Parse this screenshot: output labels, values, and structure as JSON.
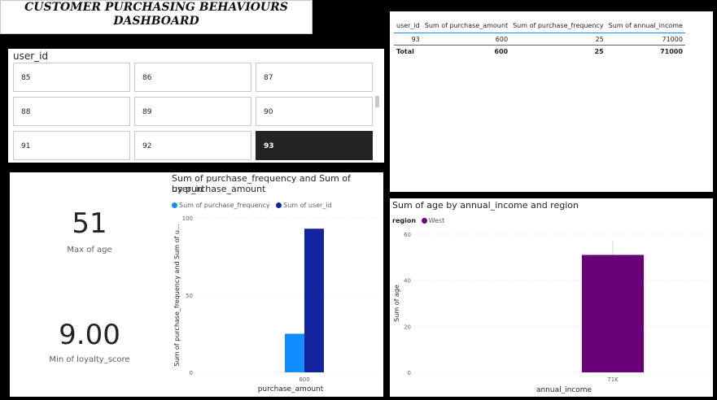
{
  "header": {
    "title_line1": "CUSTOMER PURCHASING BEHAVIOURS",
    "title_line2": "DASHBOARD"
  },
  "slicer": {
    "title": "user_id",
    "tiles": [
      "85",
      "86",
      "87",
      "88",
      "89",
      "90",
      "91",
      "92",
      "93"
    ],
    "selected": "93"
  },
  "table": {
    "headers": [
      "user_id",
      "Sum of purchase_amount",
      "Sum of purchase_frequency",
      "Sum of annual_income"
    ],
    "rows": [
      [
        "93",
        "600",
        "25",
        "71000"
      ]
    ],
    "total": [
      "Total",
      "600",
      "25",
      "71000"
    ]
  },
  "kpi": {
    "max_age": {
      "value": "51",
      "label": "Max of age"
    },
    "min_loyalty": {
      "value": "9.00",
      "label": "Min of loyalty_score"
    }
  },
  "colors": {
    "series_light": "#118dff",
    "series_dark": "#12239e",
    "west": "#6b007b"
  },
  "chart_data": [
    {
      "type": "bar",
      "title": "Sum of purchase_frequency and Sum of user_id by purchase_amount",
      "title_line1": "Sum of purchase_frequency and Sum of user_id",
      "title_line2": "by purchase_amount",
      "xlabel": "purchase_amount",
      "ylabel": "Sum of purchase_frequency and Sum of u...",
      "categories": [
        "600"
      ],
      "series": [
        {
          "name": "Sum of purchase_frequency",
          "values": [
            25
          ],
          "color": "#118dff"
        },
        {
          "name": "Sum of user_id",
          "values": [
            93
          ],
          "color": "#12239e"
        }
      ],
      "ylim": [
        0,
        100
      ],
      "yticks": [
        0,
        50,
        100
      ],
      "grid": true
    },
    {
      "type": "bar",
      "title": "Sum of age by annual_income and region",
      "xlabel": "annual_income",
      "ylabel": "Sum of age",
      "legend_title": "region",
      "categories": [
        "71K"
      ],
      "series": [
        {
          "name": "West",
          "values": [
            51
          ],
          "color": "#6b007b"
        }
      ],
      "ylim": [
        0,
        60
      ],
      "yticks": [
        0,
        20,
        40,
        60
      ],
      "grid": true
    }
  ]
}
